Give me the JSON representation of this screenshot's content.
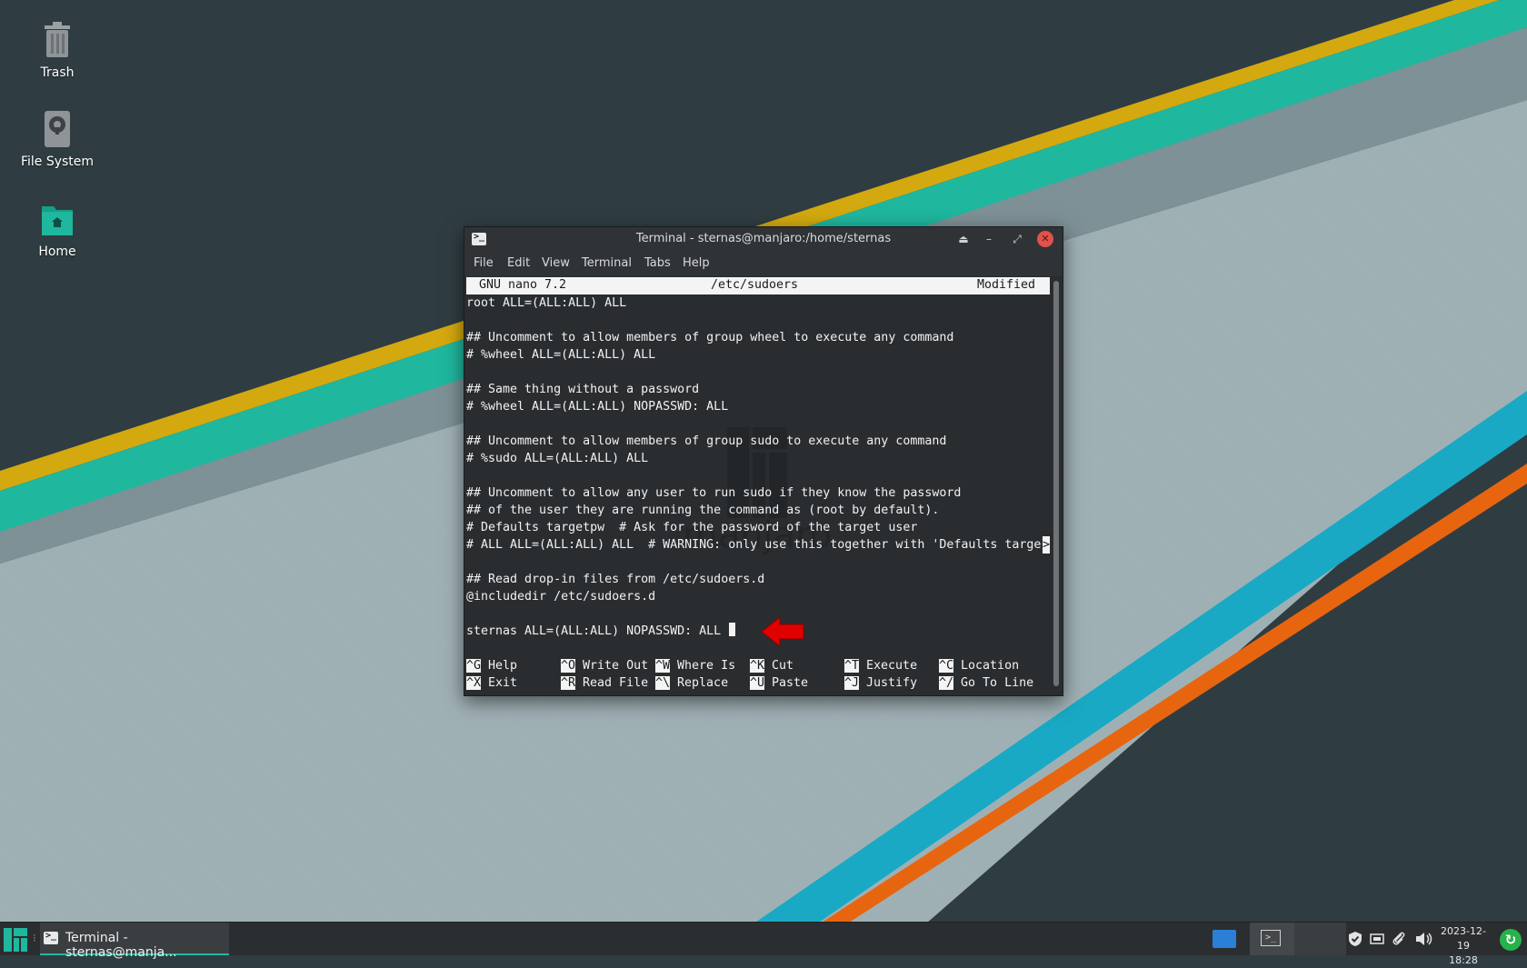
{
  "desktop": {
    "icons": [
      {
        "label": "Trash"
      },
      {
        "label": "File System"
      },
      {
        "label": "Home"
      }
    ]
  },
  "window": {
    "title": "Terminal - sternas@manjaro:/home/sternas",
    "menu": [
      "File",
      "Edit",
      "View",
      "Terminal",
      "Tabs",
      "Help"
    ],
    "buttons": {
      "shade": "⏏",
      "minimize": "–",
      "maximize": "⤢",
      "close": "✕"
    }
  },
  "nano": {
    "version": "GNU nano 7.2",
    "filename": "/etc/sudoers",
    "status": "Modified",
    "lines": [
      "root ALL=(ALL:ALL) ALL",
      "",
      "## Uncomment to allow members of group wheel to execute any command",
      "# %wheel ALL=(ALL:ALL) ALL",
      "",
      "## Same thing without a password",
      "# %wheel ALL=(ALL:ALL) NOPASSWD: ALL",
      "",
      "## Uncomment to allow members of group sudo to execute any command",
      "# %sudo ALL=(ALL:ALL) ALL",
      "",
      "## Uncomment to allow any user to run sudo if they know the password",
      "## of the user they are running the command as (root by default).",
      "# Defaults targetpw  # Ask for the password of the target user",
      "# ALL ALL=(ALL:ALL) ALL  # WARNING: only use this together with 'Defaults targe",
      "",
      "## Read drop-in files from /etc/sudoers.d",
      "@includedir /etc/sudoers.d",
      "",
      "sternas ALL=(ALL:ALL) NOPASSWD: ALL "
    ],
    "overflow_marker": ">",
    "shortcuts": [
      {
        "key": "^G",
        "label": "Help"
      },
      {
        "key": "^O",
        "label": "Write Out"
      },
      {
        "key": "^W",
        "label": "Where Is"
      },
      {
        "key": "^K",
        "label": "Cut"
      },
      {
        "key": "^T",
        "label": "Execute"
      },
      {
        "key": "^C",
        "label": "Location"
      },
      {
        "key": "^X",
        "label": "Exit"
      },
      {
        "key": "^R",
        "label": "Read File"
      },
      {
        "key": "^\\",
        "label": "Replace"
      },
      {
        "key": "^U",
        "label": "Paste"
      },
      {
        "key": "^J",
        "label": "Justify"
      },
      {
        "key": "^/",
        "label": "Go To Line"
      }
    ],
    "watermark_text": "manjaro"
  },
  "taskbar": {
    "separator": "⁝",
    "task_label": "Terminal - sternas@manja...",
    "workspace_2_glyph": ">_",
    "clock_date": "2023-12-19",
    "clock_time": "18:28",
    "tray_icons": [
      "shield-icon",
      "network-icon",
      "paperclip-icon",
      "volume-icon"
    ],
    "update_glyph": "↻"
  },
  "colors": {
    "accent": "#1fb79e",
    "yellow_stripe": "#d4a90f",
    "teal_stripe": "#1fb79e",
    "cyan_stripe": "#1aa9c4",
    "orange_stripe": "#e8650f",
    "close_button": "#e0524c",
    "arrow": "#e00000"
  }
}
